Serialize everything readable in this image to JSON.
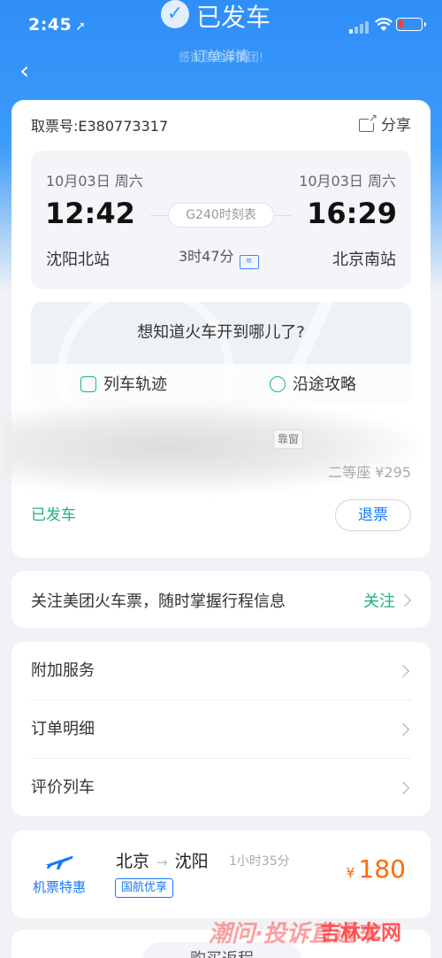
{
  "status_bar": {
    "time": "2:45"
  },
  "header": {
    "title": "已发车",
    "subtitle": "订单详情",
    "subtitle_faded": "感谢您选择美团!"
  },
  "order": {
    "ticket_label": "取票号:E380773317",
    "share_label": "分享",
    "departure": {
      "date": "10月03日 周六",
      "time": "12:42",
      "station": "沈阳北站"
    },
    "arrival": {
      "date": "10月03日 周六",
      "time": "16:29",
      "station": "北京南站"
    },
    "train_schedule": "G240时刻表",
    "duration": "3时47分",
    "map_question": "想知道火车开到哪儿了?",
    "map_buttons": [
      "列车轨迹",
      "沿途攻略"
    ],
    "seat_tag": "靠窗",
    "seat_info": "二等座 ¥295",
    "state": "已发车",
    "refund_label": "退票"
  },
  "follow": {
    "text": "关注美团火车票，随时掌握行程信息",
    "button": "关注"
  },
  "menu": [
    "附加服务",
    "订单明细",
    "评价列车"
  ],
  "flight": {
    "label": "机票特惠",
    "from": "北京",
    "to": "沈阳",
    "duration": "1小时35分",
    "badge": "国航优享",
    "currency": "¥",
    "price": "180"
  },
  "bottom": {
    "label": "购买返程"
  },
  "watermark": {
    "left": "潮问·投诉直通车",
    "right": "吉林龙网"
  },
  "colors": {
    "primary": "#2f8ef7",
    "accent_green": "#22b07d",
    "price": "#ff6a00",
    "link": "#1677ff"
  }
}
